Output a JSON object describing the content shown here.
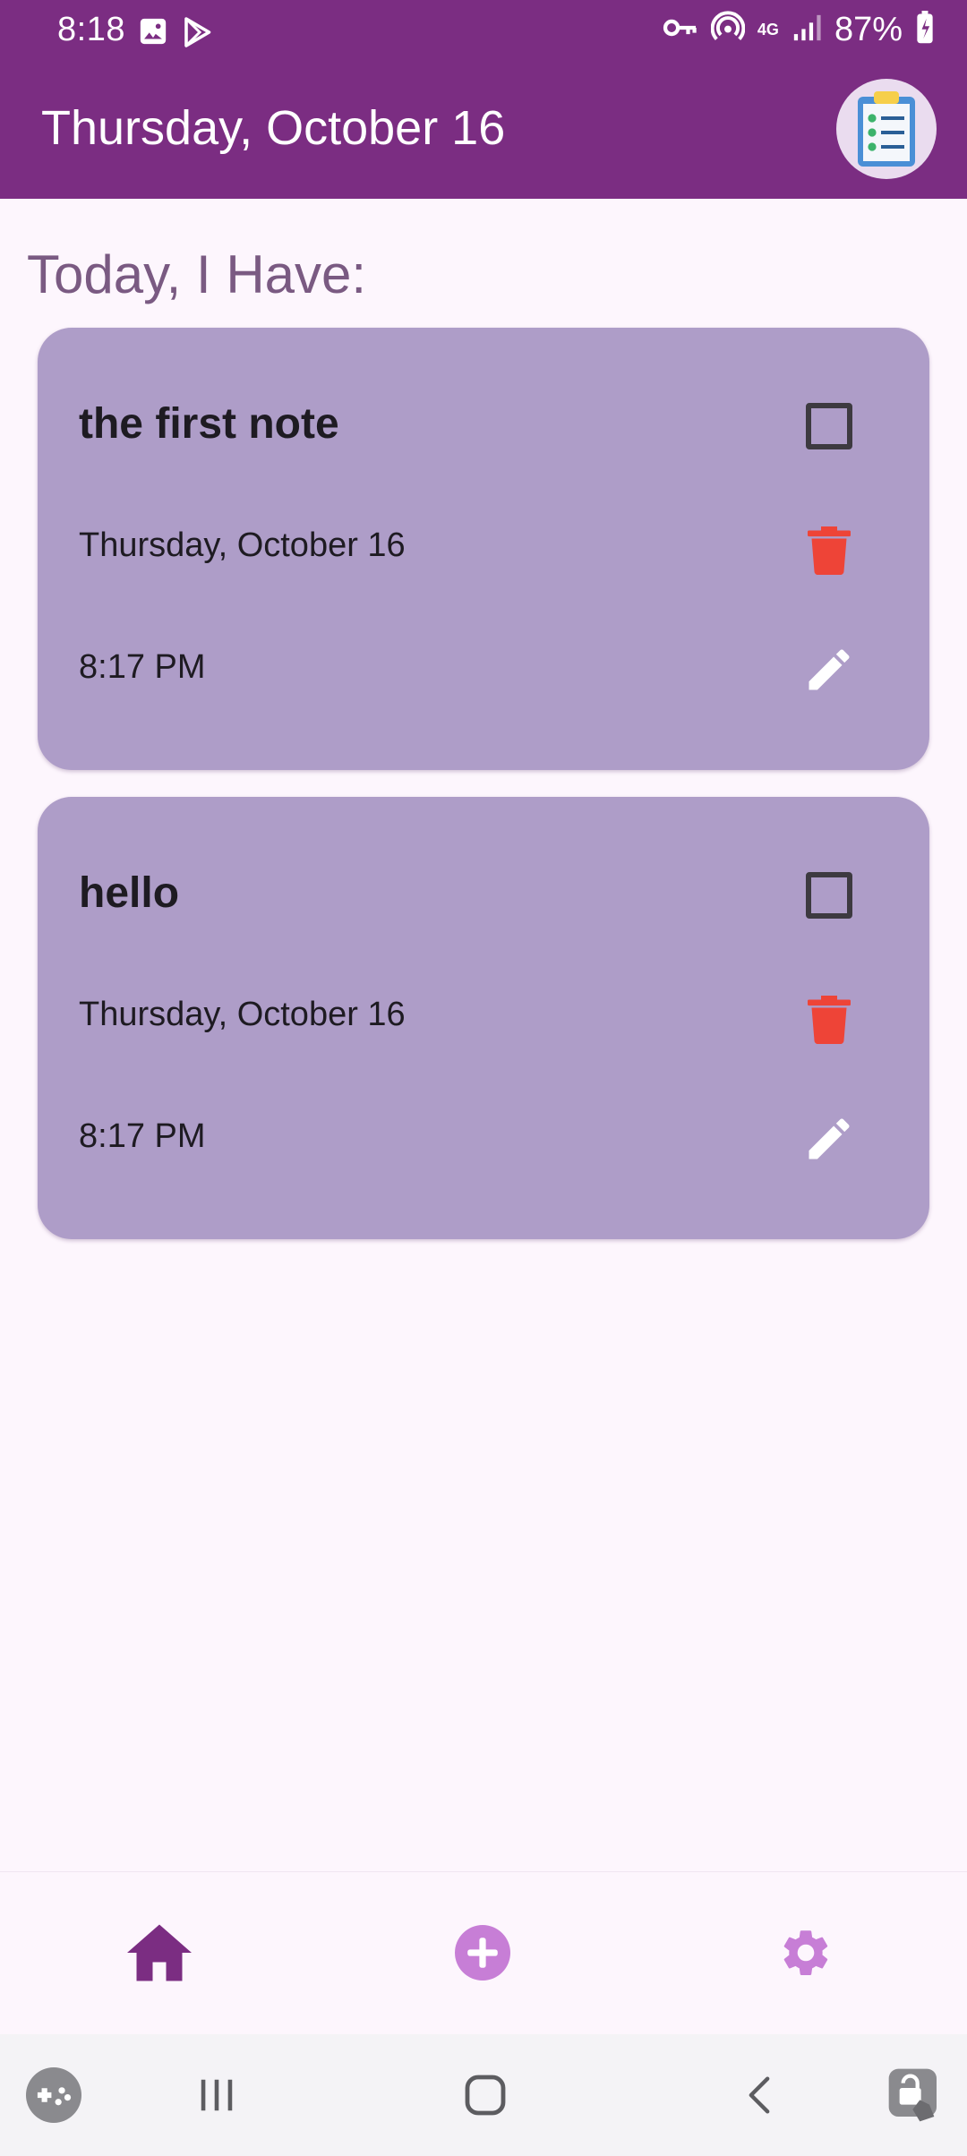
{
  "status_bar": {
    "time": "8:18",
    "network": "4G",
    "battery": "87%"
  },
  "app_bar": {
    "title": "Thursday, October 16"
  },
  "section_heading": "Today, I Have:",
  "notes": [
    {
      "title": "the first note",
      "date": "Thursday, October 16",
      "time": "8:17 PM",
      "checked": false
    },
    {
      "title": "hello",
      "date": "Thursday, October 16",
      "time": "8:17 PM",
      "checked": false
    }
  ],
  "bottom_nav": {
    "items": [
      {
        "icon": "home-icon",
        "active": true
      },
      {
        "icon": "add-circle-icon",
        "active": false
      },
      {
        "icon": "gear-icon",
        "active": false
      }
    ]
  },
  "colors": {
    "app_bar": "#7b2d82",
    "card": "#ae9dc8",
    "delete": "#ee4437",
    "nav_active": "#7b2d82",
    "nav_inactive": "#c77ed6"
  }
}
